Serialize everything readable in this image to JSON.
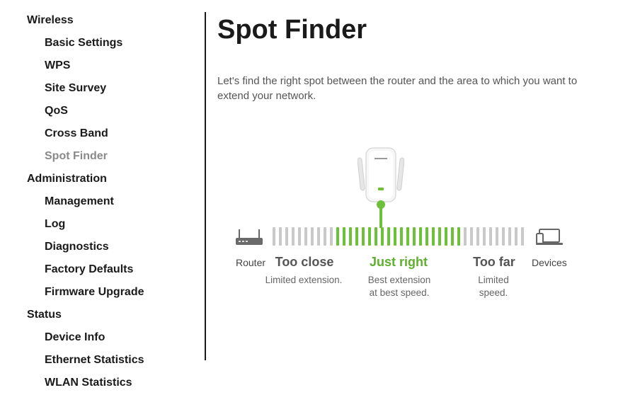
{
  "sidebar": {
    "groups": [
      {
        "label": "Wireless",
        "items": [
          "Basic Settings",
          "WPS",
          "Site Survey",
          "QoS",
          "Cross Band",
          "Spot Finder"
        ]
      },
      {
        "label": "Administration",
        "items": [
          "Management",
          "Log",
          "Diagnostics",
          "Factory Defaults",
          "Firmware Upgrade"
        ]
      },
      {
        "label": "Status",
        "items": [
          "Device Info",
          "Ethernet Statistics",
          "WLAN Statistics"
        ]
      }
    ],
    "active_item": "Spot Finder"
  },
  "main": {
    "title": "Spot Finder",
    "intro": "Let's find the right spot between the router and the area to which you want to extend your network."
  },
  "diagram": {
    "router_label": "Router",
    "devices_label": "Devices",
    "zones": [
      {
        "title": "Too close",
        "desc": "Limited extension."
      },
      {
        "title": "Just right",
        "desc": "Best extension at best speed."
      },
      {
        "title": "Too far",
        "desc": "Limited speed."
      }
    ],
    "colors": {
      "good": "#6cc138",
      "neutral": "#c9c9c9"
    },
    "icons": {
      "router": "router-icon",
      "devices": "devices-icon",
      "extender": "range-extender-icon"
    }
  }
}
